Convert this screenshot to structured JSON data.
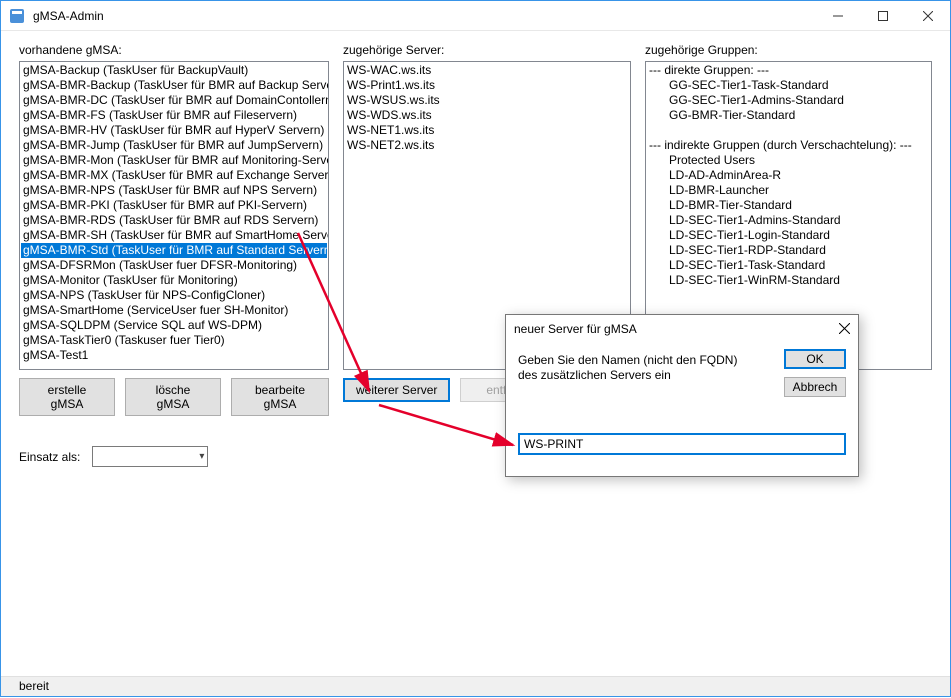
{
  "window": {
    "title": "gMSA-Admin"
  },
  "labels": {
    "col1": "vorhandene gMSA:",
    "col2": "zugehörige Server:",
    "col3": "zugehörige Gruppen:",
    "einsatz": "Einsatz als:"
  },
  "gmsa_list": [
    {
      "text": "gMSA-Backup (TaskUser für BackupVault)",
      "selected": false
    },
    {
      "text": "gMSA-BMR-Backup (TaskUser für BMR auf Backup Servern)",
      "selected": false
    },
    {
      "text": "gMSA-BMR-DC (TaskUser für BMR auf DomainContollern)",
      "selected": false
    },
    {
      "text": "gMSA-BMR-FS (TaskUser für BMR auf Fileservern)",
      "selected": false
    },
    {
      "text": "gMSA-BMR-HV (TaskUser für BMR auf HyperV Servern)",
      "selected": false
    },
    {
      "text": "gMSA-BMR-Jump (TaskUser für BMR auf JumpServern)",
      "selected": false
    },
    {
      "text": "gMSA-BMR-Mon (TaskUser für BMR auf Monitoring-Servern)",
      "selected": false
    },
    {
      "text": "gMSA-BMR-MX (TaskUser für BMR auf Exchange Servern)",
      "selected": false
    },
    {
      "text": "gMSA-BMR-NPS (TaskUser für BMR auf NPS Servern)",
      "selected": false
    },
    {
      "text": "gMSA-BMR-PKI (TaskUser für BMR auf PKI-Servern)",
      "selected": false
    },
    {
      "text": "gMSA-BMR-RDS (TaskUser für BMR auf RDS Servern)",
      "selected": false
    },
    {
      "text": "gMSA-BMR-SH (TaskUser für BMR auf SmartHome Servern)",
      "selected": false
    },
    {
      "text": "gMSA-BMR-Std (TaskUser für BMR auf Standard Servern)",
      "selected": true
    },
    {
      "text": "gMSA-DFSRMon (TaskUser fuer DFSR-Monitoring)",
      "selected": false
    },
    {
      "text": "gMSA-Monitor (TaskUser für Monitoring)",
      "selected": false
    },
    {
      "text": "gMSA-NPS (TaskUser für NPS-ConfigCloner)",
      "selected": false
    },
    {
      "text": "gMSA-SmartHome (ServiceUser fuer SH-Monitor)",
      "selected": false
    },
    {
      "text": "gMSA-SQLDPM (Service SQL auf WS-DPM)",
      "selected": false
    },
    {
      "text": "gMSA-TaskTier0 (Taskuser fuer Tier0)",
      "selected": false
    },
    {
      "text": "gMSA-Test1",
      "selected": false
    }
  ],
  "server_list": [
    "WS-WAC.ws.its",
    "WS-Print1.ws.its",
    "WS-WSUS.ws.its",
    "WS-WDS.ws.its",
    "WS-NET1.ws.its",
    "WS-NET2.ws.its"
  ],
  "groups": {
    "direct_header": "--- direkte Gruppen: ---",
    "direct": [
      "GG-SEC-Tier1-Task-Standard",
      "GG-SEC-Tier1-Admins-Standard",
      "GG-BMR-Tier-Standard"
    ],
    "indirect_header": "--- indirekte Gruppen (durch Verschachtelung): ---",
    "indirect": [
      "Protected Users",
      "LD-AD-AdminArea-R",
      "LD-BMR-Launcher",
      "LD-BMR-Tier-Standard",
      "LD-SEC-Tier1-Admins-Standard",
      "LD-SEC-Tier1-Login-Standard",
      "LD-SEC-Tier1-RDP-Standard",
      "LD-SEC-Tier1-Task-Standard",
      "LD-SEC-Tier1-WinRM-Standard"
    ]
  },
  "buttons": {
    "create": "erstelle gMSA",
    "delete": "lösche gMSA",
    "edit": "bearbeite gMSA",
    "add_server": "weiterer Server",
    "remove_server": "entferne"
  },
  "dialog": {
    "title": "neuer Server für gMSA",
    "message": "Geben Sie den Namen (nicht den FQDN) des zusätzlichen Servers ein",
    "ok": "OK",
    "cancel": "Abbrech",
    "input_value": "WS-PRINT"
  },
  "status": "bereit",
  "combo_value": ""
}
